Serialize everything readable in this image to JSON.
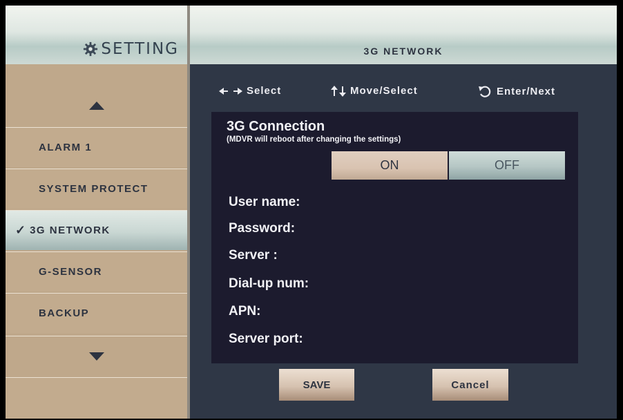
{
  "sidebar": {
    "title": "SETTING",
    "title_icon": "gear-icon",
    "items": [
      {
        "label": "ALARM 1"
      },
      {
        "label": "SYSTEM PROTECT"
      },
      {
        "label": "3G NETWORK",
        "active": true,
        "checkmark": "✓"
      },
      {
        "label": "G-SENSOR"
      },
      {
        "label": "BACKUP"
      }
    ]
  },
  "header": {
    "title": "3G NETWORK"
  },
  "hints": {
    "select": "Select",
    "move_select": "Move/Select",
    "enter_next": "Enter/Next"
  },
  "connection": {
    "title": "3G Connection",
    "note": "(MDVR will reboot after changing the settings)",
    "on_label": "ON",
    "off_label": "OFF",
    "selected": "ON"
  },
  "fields": [
    {
      "label": "User name:"
    },
    {
      "label": "Password:"
    },
    {
      "label": "Server :"
    },
    {
      "label": "Dial-up num:"
    },
    {
      "label": "APN:"
    },
    {
      "label": "Server port:"
    }
  ],
  "buttons": {
    "save": "SAVE",
    "cancel": "Cancel"
  },
  "colors": {
    "panel": "#1c1b2e",
    "background": "#2f3746",
    "sidebar_item": "#c2ab8e",
    "active_item": "#c9d7d3",
    "text_light": "#f1f1f5",
    "text_dark": "#2d3340"
  }
}
